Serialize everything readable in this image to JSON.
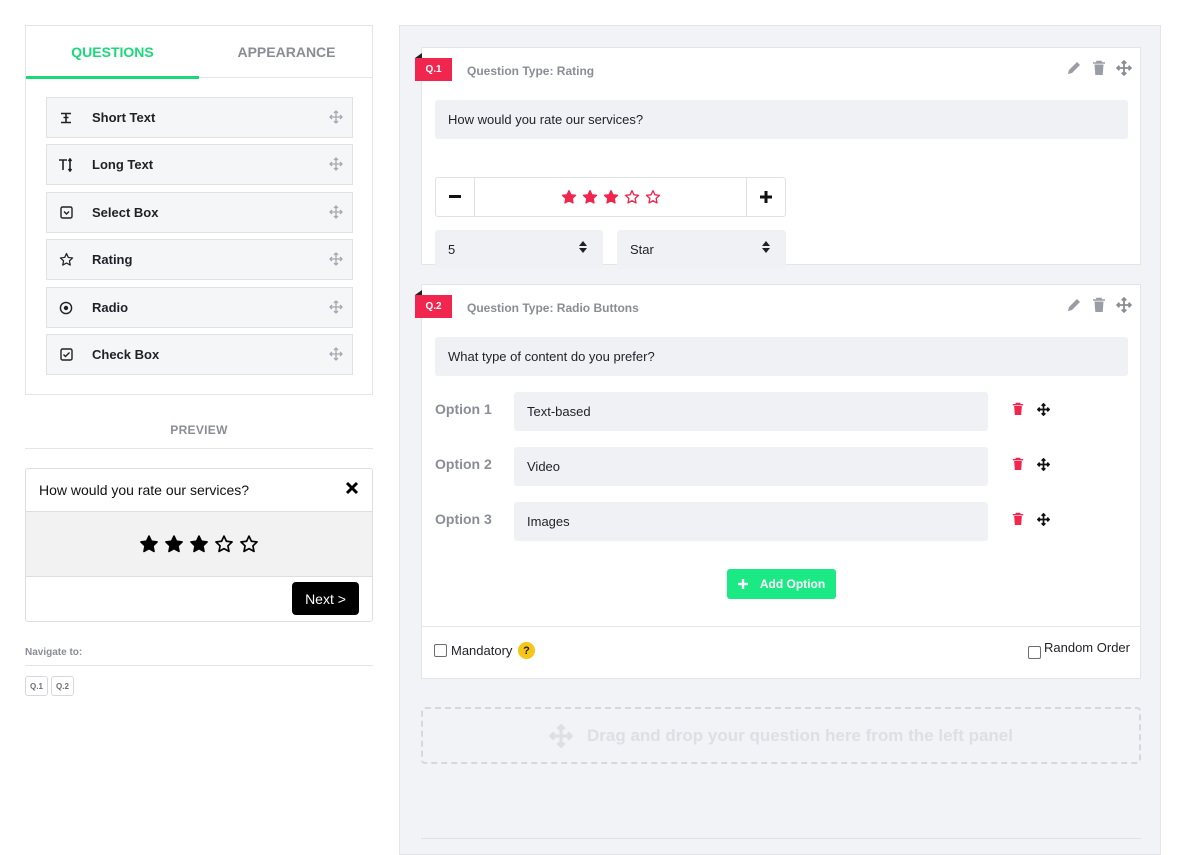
{
  "tabs": {
    "questions": "QUESTIONS",
    "appearance": "APPEARANCE"
  },
  "question_types": [
    {
      "label": "Short Text",
      "icon": "short-text-icon"
    },
    {
      "label": "Long Text",
      "icon": "long-text-icon"
    },
    {
      "label": "Select Box",
      "icon": "select-box-icon"
    },
    {
      "label": "Rating",
      "icon": "star-icon"
    },
    {
      "label": "Radio",
      "icon": "radio-icon"
    },
    {
      "label": "Check Box",
      "icon": "checkbox-icon"
    }
  ],
  "preview": {
    "title": "PREVIEW",
    "question": "How would you rate our services?",
    "rating": 3,
    "max_rating": 5,
    "next_label": "Next >"
  },
  "navigate": {
    "label": "Navigate to:",
    "chips": [
      "Q.1",
      "Q.2"
    ]
  },
  "q1": {
    "badge": "Q.1",
    "type_label": "Question Type: Rating",
    "text": "How would you rate our services?",
    "rating": 3,
    "max_rating": 5,
    "scale_value": "5",
    "shape_value": "Star"
  },
  "q2": {
    "badge": "Q.2",
    "type_label": "Question Type: Radio Buttons",
    "text": "What type of content do you prefer?",
    "options": [
      {
        "label": "Option 1",
        "value": "Text-based"
      },
      {
        "label": "Option 2",
        "value": "Video"
      },
      {
        "label": "Option 3",
        "value": "Images"
      }
    ],
    "add_option_label": "Add Option",
    "mandatory_label": "Mandatory",
    "help_symbol": "?",
    "random_order_label": "Random Order"
  },
  "dropzone": {
    "text": "Drag and drop your question here from the left panel"
  },
  "colors": {
    "accent_green": "#1bd97a",
    "badge_red": "#f0264f",
    "star_red": "#f0264f",
    "delete_red": "#f0264f",
    "help_yellow": "#f5c518"
  }
}
